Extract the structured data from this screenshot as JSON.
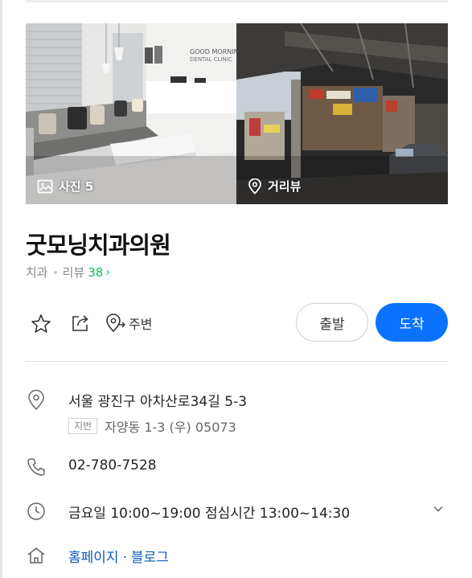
{
  "place": {
    "title": "굿모닝치과의원",
    "category": "치과",
    "review_label": "리뷰",
    "review_count": "38",
    "review_chevron": "›"
  },
  "photos": {
    "photo_label": "사진 5",
    "roadview_label": "거리뷰",
    "clinic_sign_line1": "GOOD MORNING",
    "clinic_sign_line2": "DENTAL CLINIC"
  },
  "actions": {
    "around_label": "주변",
    "depart_label": "출발",
    "arrive_label": "도착"
  },
  "info": {
    "address": "서울 광진구 아차산로34길 5-3",
    "jibun_tag": "지번",
    "jibun_address": "자양동 1-3 (우) 05073",
    "phone": "02-780-7528",
    "hours": "금요일 10:00~19:00 점심시간 13:00~14:30",
    "homepage_label": "홈페이지",
    "homepage_sep": "·",
    "blog_label": "블로그"
  },
  "icons": {
    "image": "image-icon",
    "roadview": "location-pin-icon",
    "star": "star-icon",
    "share": "share-icon",
    "around": "around-pin-icon",
    "address": "map-pin-icon",
    "phone": "phone-icon",
    "clock": "clock-icon",
    "expand": "chevron-down-icon",
    "home": "home-icon"
  },
  "colors": {
    "accent_blue": "#0a72ff",
    "review_green": "#03c75a",
    "link_blue": "#0b59b8"
  }
}
